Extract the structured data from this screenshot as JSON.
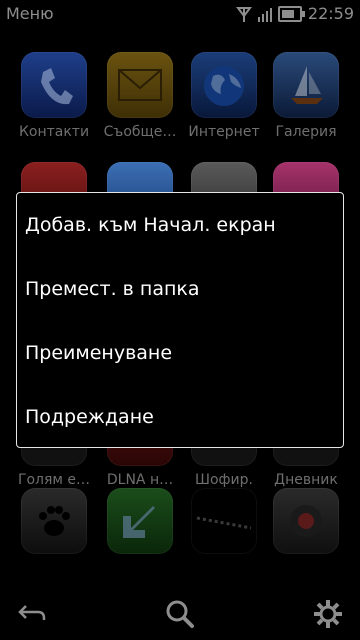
{
  "statusbar": {
    "title": "Меню",
    "time": "22:59"
  },
  "apps": {
    "row1": [
      {
        "label": "Контакти",
        "icon": "phone-icon"
      },
      {
        "label": "Съобще…",
        "icon": "envelope-icon"
      },
      {
        "label": "Интернет",
        "icon": "globe-icon"
      },
      {
        "label": "Галерия",
        "icon": "sailboat-icon"
      }
    ],
    "row3": [
      {
        "label": "Голям е…"
      },
      {
        "label": "DLNA н…"
      },
      {
        "label": "Шофир."
      },
      {
        "label": "Дневник"
      }
    ]
  },
  "menu": {
    "items": [
      {
        "label": "Добав. към Начал. екран"
      },
      {
        "label": "Премест. в папка"
      },
      {
        "label": "Преименуване"
      },
      {
        "label": "Подреждане"
      }
    ]
  },
  "toolbar": {
    "icons": [
      "back-icon",
      "search-icon",
      "settings-icon"
    ]
  },
  "colors": {
    "background": "#000000",
    "menu_border": "#e7e7e7",
    "dim_text": "#6f6f6f"
  }
}
